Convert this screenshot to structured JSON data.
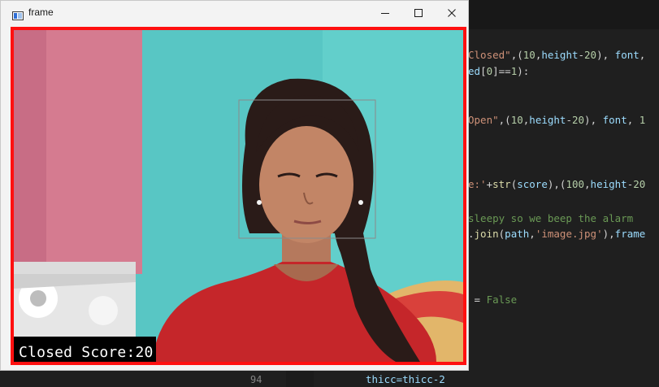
{
  "window": {
    "title": "frame",
    "controls": {
      "minimize": "minimize-icon",
      "maximize": "maximize-icon",
      "close": "close-icon"
    }
  },
  "overlay": {
    "status_label": "Closed",
    "score_label": "Score:20"
  },
  "editor": {
    "lines": [
      {
        "parts": [
          {
            "t": "Closed\"",
            "c": "t-str"
          },
          {
            "t": ",(",
            "c": "t-op"
          },
          {
            "t": "10",
            "c": "t-num"
          },
          {
            "t": ",",
            "c": "t-op"
          },
          {
            "t": "height",
            "c": "t-id"
          },
          {
            "t": "-",
            "c": "t-op"
          },
          {
            "t": "20",
            "c": "t-num"
          },
          {
            "t": "), ",
            "c": "t-op"
          },
          {
            "t": "font",
            "c": "t-id"
          },
          {
            "t": ",",
            "c": "t-op"
          }
        ]
      },
      {
        "parts": [
          {
            "t": "ed",
            "c": "t-id"
          },
          {
            "t": "[",
            "c": "t-op"
          },
          {
            "t": "0",
            "c": "t-num"
          },
          {
            "t": "]==",
            "c": "t-op"
          },
          {
            "t": "1",
            "c": "t-num"
          },
          {
            "t": "):",
            "c": "t-op"
          }
        ]
      },
      {
        "parts": [
          {
            "t": "Open\"",
            "c": "t-str"
          },
          {
            "t": ",(",
            "c": "t-op"
          },
          {
            "t": "10",
            "c": "t-num"
          },
          {
            "t": ",",
            "c": "t-op"
          },
          {
            "t": "height",
            "c": "t-id"
          },
          {
            "t": "-",
            "c": "t-op"
          },
          {
            "t": "20",
            "c": "t-num"
          },
          {
            "t": "), ",
            "c": "t-op"
          },
          {
            "t": "font",
            "c": "t-id"
          },
          {
            "t": ", ",
            "c": "t-op"
          },
          {
            "t": "1",
            "c": "t-num"
          }
        ]
      },
      {
        "parts": [
          {
            "t": "e:'",
            "c": "t-str"
          },
          {
            "t": "+",
            "c": "t-op"
          },
          {
            "t": "str",
            "c": "t-fn"
          },
          {
            "t": "(",
            "c": "t-op"
          },
          {
            "t": "score",
            "c": "t-id"
          },
          {
            "t": "),(",
            "c": "t-op"
          },
          {
            "t": "100",
            "c": "t-num"
          },
          {
            "t": ",",
            "c": "t-op"
          },
          {
            "t": "height",
            "c": "t-id"
          },
          {
            "t": "-",
            "c": "t-op"
          },
          {
            "t": "20",
            "c": "t-num"
          }
        ]
      },
      {
        "parts": [
          {
            "t": "sleepy so we beep the alarm",
            "c": "t-cm"
          }
        ]
      },
      {
        "parts": [
          {
            "t": ".",
            "c": "t-op"
          },
          {
            "t": "join",
            "c": "t-fn"
          },
          {
            "t": "(",
            "c": "t-op"
          },
          {
            "t": "path",
            "c": "t-id"
          },
          {
            "t": ",",
            "c": "t-op"
          },
          {
            "t": "'image.jpg'",
            "c": "t-str"
          },
          {
            "t": "),",
            "c": "t-op"
          },
          {
            "t": "frame",
            "c": "t-id"
          }
        ]
      },
      {
        "parts": [
          {
            "t": " = ",
            "c": "t-op"
          },
          {
            "t": "False",
            "c": "t-cm"
          }
        ]
      }
    ],
    "line_number": "94",
    "bottom_line": "thicc=thicc-2"
  }
}
